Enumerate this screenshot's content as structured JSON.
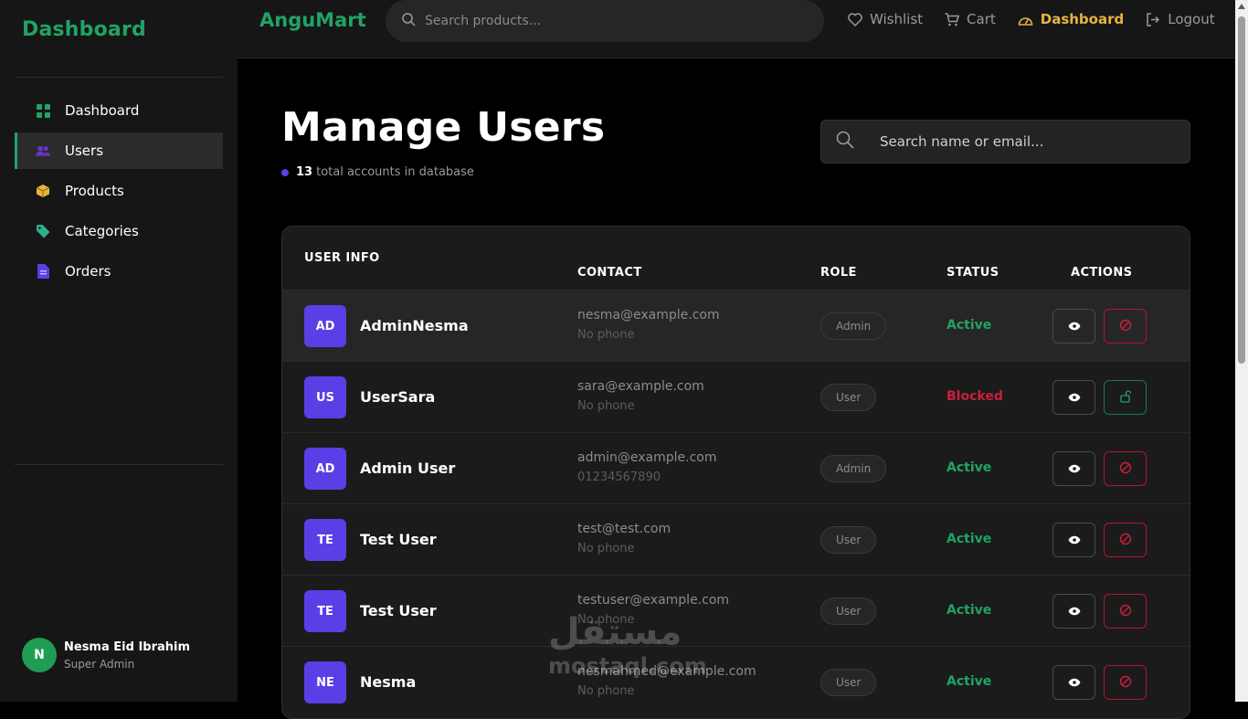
{
  "sidebar": {
    "brand": "Dashboard",
    "items": [
      {
        "label": "Dashboard",
        "icon": "grid-icon",
        "color": "#21a366"
      },
      {
        "label": "Users",
        "icon": "users-icon",
        "color": "#6a35c9",
        "active": true
      },
      {
        "label": "Products",
        "icon": "box-icon",
        "color": "#e8b341"
      },
      {
        "label": "Categories",
        "icon": "tag-icon",
        "color": "#2fae8c"
      },
      {
        "label": "Orders",
        "icon": "file-icon",
        "color": "#5b3ee6"
      }
    ],
    "profile": {
      "initial": "N",
      "name": "Nesma Eid Ibrahim",
      "role": "Super Admin"
    }
  },
  "topbar": {
    "logo": "AnguMart",
    "search_placeholder": "Search products...",
    "links": [
      {
        "label": "Wishlist",
        "icon": "heart-icon"
      },
      {
        "label": "Cart",
        "icon": "cart-icon"
      },
      {
        "label": "Dashboard",
        "icon": "gauge-icon",
        "active": true
      },
      {
        "label": "Logout",
        "icon": "logout-icon"
      }
    ]
  },
  "page": {
    "title": "Manage Users",
    "count": "13",
    "count_suffix": "total accounts in database",
    "search_placeholder": "Search name or email..."
  },
  "table": {
    "headers": {
      "user_info": "USER INFO",
      "contact": "CONTACT",
      "role": "ROLE",
      "status": "STATUS",
      "actions": "ACTIONS"
    },
    "rows": [
      {
        "initials": "AD",
        "name": "AdminNesma",
        "email": "nesma@example.com",
        "phone": "No phone",
        "role": "Admin",
        "status": "Active",
        "state": "active"
      },
      {
        "initials": "US",
        "name": "UserSara",
        "email": "sara@example.com",
        "phone": "No phone",
        "role": "User",
        "status": "Blocked",
        "state": "blocked"
      },
      {
        "initials": "AD",
        "name": "Admin User",
        "email": "admin@example.com",
        "phone": "01234567890",
        "role": "Admin",
        "status": "Active",
        "state": "active"
      },
      {
        "initials": "TE",
        "name": "Test User",
        "email": "test@test.com",
        "phone": "No phone",
        "role": "User",
        "status": "Active",
        "state": "active"
      },
      {
        "initials": "TE",
        "name": "Test User",
        "email": "testuser@example.com",
        "phone": "No phone",
        "role": "User",
        "status": "Active",
        "state": "active"
      },
      {
        "initials": "NE",
        "name": "Nesma",
        "email": "nesmahmed@example.com",
        "phone": "No phone",
        "role": "User",
        "status": "Active",
        "state": "active"
      }
    ]
  },
  "watermark": {
    "arabic": "مستقل",
    "latin": "mostaql.com"
  },
  "colors": {
    "accent_green": "#21a366",
    "accent_purple": "#5b3ee6",
    "accent_gold": "#e8b341",
    "danger": "#c8203a"
  }
}
